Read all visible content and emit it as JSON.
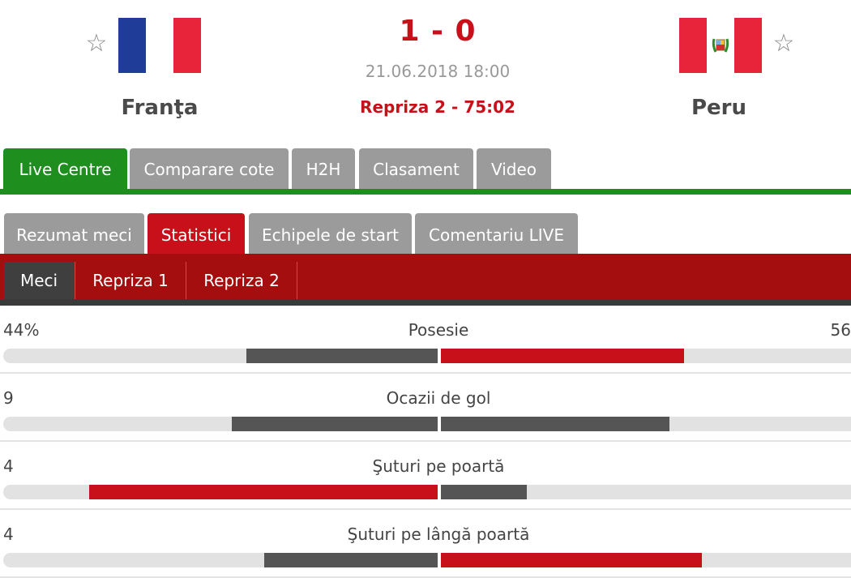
{
  "match": {
    "home_team": "Franţa",
    "away_team": "Peru",
    "score": "1 - 0",
    "datetime": "21.06.2018 18:00",
    "status": "Repriza 2 - 75:02",
    "star_glyph": "☆"
  },
  "main_tabs": [
    "Live Centre",
    "Comparare cote",
    "H2H",
    "Clasament",
    "Video"
  ],
  "sub_tabs": [
    "Rezumat meci",
    "Statistici",
    "Echipele de start",
    "Comentariu LIVE"
  ],
  "period_tabs": [
    "Meci",
    "Repriza 1",
    "Repriza 2"
  ],
  "stats": [
    {
      "label": "Posesie",
      "home": "44%",
      "away": "56",
      "home_value": 44,
      "away_value": 56,
      "home_leads": false
    },
    {
      "label": "Ocazii de gol",
      "home": "9",
      "away": "",
      "home_value": 9,
      "away_value": 10,
      "home_leads": false
    },
    {
      "label": "Şuturi pe poartă",
      "home": "4",
      "away": "",
      "home_value": 4,
      "away_value": 1,
      "home_leads": true
    },
    {
      "label": "Şuturi pe lângă poartă",
      "home": "4",
      "away": "",
      "home_value": 4,
      "away_value": 6,
      "home_leads": false
    }
  ],
  "colors": {
    "accent_red": "#c8101a",
    "green": "#1e8e1e",
    "dark_bar": "#555555",
    "track": "#e2e2e2"
  }
}
